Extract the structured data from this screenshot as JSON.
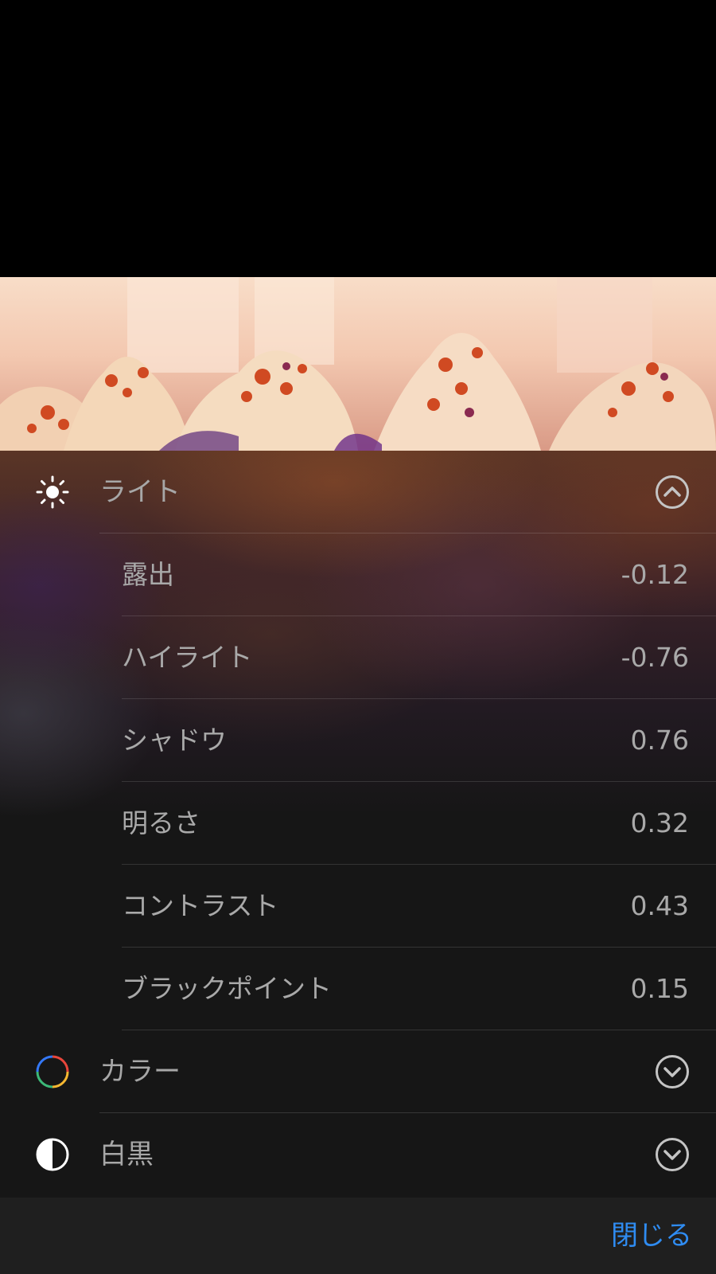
{
  "photo": {
    "subject": "cupcakes-photo"
  },
  "sections": {
    "light": {
      "label": "ライト",
      "icon": "sun-icon",
      "chevron": "chevron-up-icon",
      "items": [
        {
          "label": "露出",
          "value": "-0.12"
        },
        {
          "label": "ハイライト",
          "value": "-0.76"
        },
        {
          "label": "シャドウ",
          "value": "0.76"
        },
        {
          "label": "明るさ",
          "value": "0.32"
        },
        {
          "label": "コントラスト",
          "value": "0.43"
        },
        {
          "label": "ブラックポイント",
          "value": "0.15"
        }
      ]
    },
    "color": {
      "label": "カラー",
      "icon": "color-ring-icon",
      "chevron": "chevron-down-icon"
    },
    "bw": {
      "label": "白黒",
      "icon": "half-circle-icon",
      "chevron": "chevron-down-icon"
    }
  },
  "footer": {
    "close_label": "閉じる"
  },
  "colors": {
    "accent": "#2f8cf2",
    "text": "#a9a9a9",
    "panel": "#161616",
    "footer": "#1f1f1f"
  }
}
